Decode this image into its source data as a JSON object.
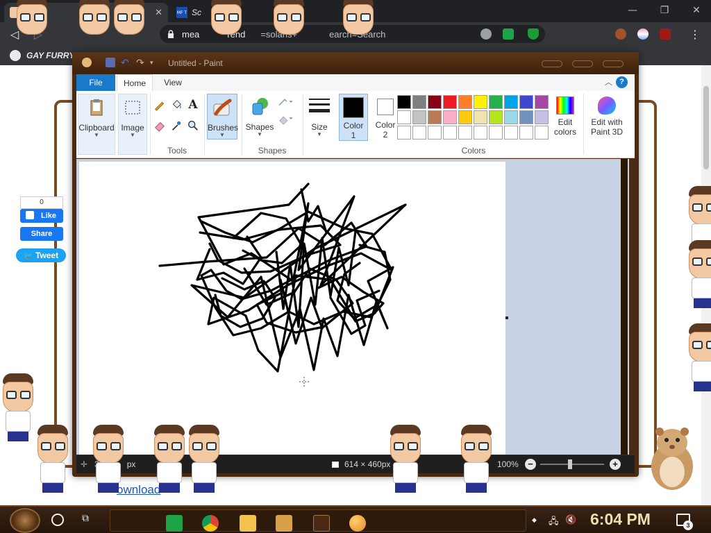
{
  "browser": {
    "tabs": [
      {
        "label": "",
        "favicon": "cartoon-favicon"
      },
      {
        "label": "Sc",
        "favicon_text": "MF T"
      }
    ],
    "address": {
      "prefix": "mea",
      "host": "rend",
      "query_tail": "=solaris+",
      "query_end": "earch=Search",
      "extensions": [
        "site-info-icon",
        "green-badge-extension",
        "shield-extension"
      ]
    },
    "bookmark_label": "GAY FURRY",
    "window_controls": {
      "minimize": "—",
      "restore": "❐",
      "close": "✕"
    }
  },
  "webpage": {
    "like_count": "0",
    "like_label": "Like",
    "share_label": "Share",
    "tweet_label": "Tweet",
    "download_link": "ownload"
  },
  "paint": {
    "title": "Untitled - Paint",
    "tabs": {
      "file": "File",
      "home": "Home",
      "view": "View"
    },
    "help": "?",
    "groups": {
      "clipboard": "Clipboard",
      "image": "Image",
      "tools": "Tools",
      "brushes": "Brushes",
      "shapes_btn": "Shapes",
      "shapes_group": "Shapes",
      "size": "Size",
      "color1": "Color\n1",
      "color1_a": "Color",
      "color1_b": "1",
      "color2_a": "Color",
      "color2_b": "2",
      "colors": "Colors",
      "edit_colors_a": "Edit",
      "edit_colors_b": "colors",
      "paint3d_a": "Edit with",
      "paint3d_b": "Paint 3D"
    },
    "palette_row1": [
      "#000000",
      "#7f7f7f",
      "#880015",
      "#ed1c24",
      "#ff7f27",
      "#fff200",
      "#22b14c",
      "#00a2e8",
      "#3f48cc",
      "#a349a4"
    ],
    "palette_row2": [
      "#ffffff",
      "#c3c3c3",
      "#b97a57",
      "#ffaec9",
      "#ffc90e",
      "#efe4b0",
      "#b5e61d",
      "#99d9ea",
      "#7092be",
      "#c8bfe7"
    ],
    "palette_row3": [
      "#ffffff",
      "#ffffff",
      "#ffffff",
      "#ffffff",
      "#ffffff",
      "#ffffff",
      "#ffffff",
      "#ffffff",
      "#ffffff",
      "#ffffff"
    ],
    "color1_value": "#000000",
    "color2_value": "#ffffff",
    "status": {
      "cursor_pos": "3",
      "cursor_unit": "px",
      "canvas_size": "614 × 460px",
      "zoom": "100%"
    }
  },
  "taskbar": {
    "clock": "6:04 PM",
    "notification_count": "3"
  }
}
